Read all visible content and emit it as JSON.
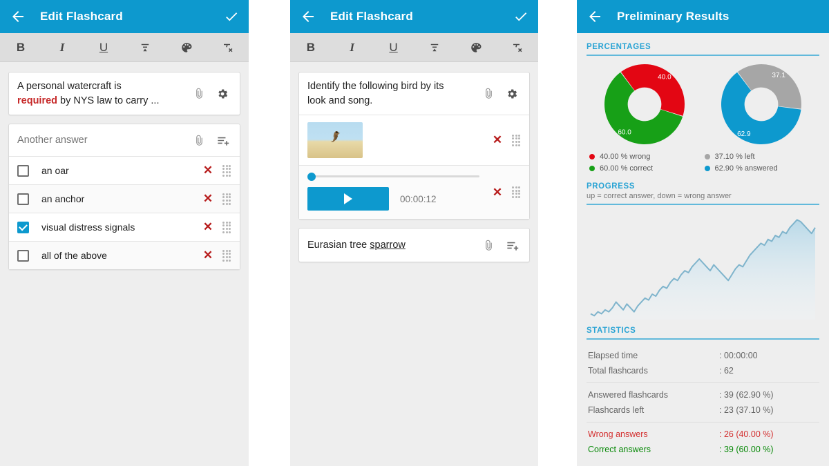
{
  "panel1": {
    "appbar": {
      "title": "Edit Flashcard",
      "back_icon": "back-arrow-icon",
      "confirm_icon": "check-icon"
    },
    "format_toolbar": [
      {
        "name": "bold",
        "glyph": "B"
      },
      {
        "name": "italic",
        "glyph": "I"
      },
      {
        "name": "underline",
        "glyph": "U"
      },
      {
        "name": "text-size",
        "glyph": "≡"
      },
      {
        "name": "text-color-palette",
        "glyph": "◕"
      },
      {
        "name": "clear-formatting",
        "glyph": "✗"
      }
    ],
    "question": {
      "line1": "A personal watercraft is",
      "keyword": "required",
      "line2_rest": " by NYS law to carry ...",
      "attach_icon": "paperclip-icon",
      "settings_icon": "gear-icon"
    },
    "answer_input": {
      "placeholder": "Another answer",
      "attach_icon": "paperclip-icon",
      "add_icon": "add-list-item-icon"
    },
    "answers": [
      {
        "label": "an oar",
        "checked": false
      },
      {
        "label": "an anchor",
        "checked": false
      },
      {
        "label": "visual distress signals",
        "checked": true
      },
      {
        "label": "all of the above",
        "checked": false
      }
    ]
  },
  "panel2": {
    "appbar": {
      "title": "Edit Flashcard",
      "back_icon": "back-arrow-icon",
      "confirm_icon": "check-icon"
    },
    "format_toolbar": [
      {
        "name": "bold",
        "glyph": "B"
      },
      {
        "name": "italic",
        "glyph": "I"
      },
      {
        "name": "underline",
        "glyph": "U"
      },
      {
        "name": "text-size",
        "glyph": "≡"
      },
      {
        "name": "text-color-palette",
        "glyph": "◕"
      },
      {
        "name": "clear-formatting",
        "glyph": "✗"
      }
    ],
    "question": {
      "line1": "Identify the following bird by its",
      "line2": "look and song.",
      "attach_icon": "paperclip-icon",
      "settings_icon": "gear-icon"
    },
    "image_attachment": {
      "alt": "bird-photo-thumbnail",
      "remove_icon": "remove-x-icon",
      "drag_icon": "drag-handle-icon"
    },
    "audio_attachment": {
      "duration": "00:00:12",
      "play_icon": "play-icon",
      "remove_icon": "remove-x-icon",
      "drag_icon": "drag-handle-icon",
      "seek_position_percent": 0
    },
    "answer": {
      "text_plain": "Eurasian tree ",
      "text_underlined": "sparrow",
      "attach_icon": "paperclip-icon",
      "add_icon": "add-list-item-icon"
    }
  },
  "panel3": {
    "appbar": {
      "title": "Preliminary Results",
      "back_icon": "back-arrow-icon"
    },
    "sections": {
      "percentages_title": "PERCENTAGES",
      "progress_title": "PROGRESS",
      "progress_subtitle": "up = correct answer, down = wrong answer",
      "statistics_title": "STATISTICS"
    },
    "legend": [
      {
        "label": "40.00 % wrong",
        "color": "#e30613"
      },
      {
        "label": "37.10 % left",
        "color": "#a6a6a6"
      },
      {
        "label": "60.00 % correct",
        "color": "#17a017"
      },
      {
        "label": "62.90 % answered",
        "color": "#0d99ce"
      }
    ],
    "statistics": [
      [
        {
          "key": "Elapsed time",
          "value": ": 00:00:00",
          "tone": "normal"
        },
        {
          "key": "Total flashcards",
          "value": ": 62",
          "tone": "normal"
        }
      ],
      [
        {
          "key": "Answered flashcards",
          "value": ": 39 (62.90 %)",
          "tone": "normal"
        },
        {
          "key": "Flashcards left",
          "value": ": 23 (37.10 %)",
          "tone": "normal"
        }
      ],
      [
        {
          "key": "Wrong answers",
          "value": ": 26 (40.00 %)",
          "tone": "wrong"
        },
        {
          "key": "Correct answers",
          "value": ": 39 (60.00 %)",
          "tone": "correct"
        }
      ]
    ]
  },
  "chart_data": [
    {
      "type": "pie",
      "title": "PERCENTAGES",
      "subtype": "donut",
      "name": "correctness-donut",
      "labels": [
        "wrong",
        "correct"
      ],
      "values": [
        40.0,
        60.0
      ],
      "data_labels": [
        "40.0",
        "60.0"
      ],
      "colors": [
        "#e30613",
        "#17a017"
      ],
      "legend": [
        "40.00 % wrong",
        "60.00 % correct"
      ],
      "legend_position": "bottom",
      "start_angle_deg": -36,
      "inner_radius_ratio": 0.42
    },
    {
      "type": "pie",
      "title": "PERCENTAGES",
      "subtype": "donut",
      "name": "completion-donut",
      "labels": [
        "left",
        "answered"
      ],
      "values": [
        37.1,
        62.9
      ],
      "data_labels": [
        "37.1",
        "62.9"
      ],
      "colors": [
        "#a6a6a6",
        "#0d99ce"
      ],
      "legend": [
        "37.10 % left",
        "62.90 % answered"
      ],
      "legend_position": "bottom",
      "start_angle_deg": -36,
      "inner_radius_ratio": 0.42
    },
    {
      "type": "area",
      "name": "progress-chart",
      "title": "PROGRESS",
      "subtitle": "up = correct answer, down = wrong answer",
      "xlabel": "",
      "ylabel": "",
      "grid": false,
      "legend_position": "none",
      "line_color": "#7fb4cc",
      "fill_top_color": "#b9d9e8",
      "fill_bottom_color": "#eef5f9",
      "x": [
        0,
        1,
        2,
        3,
        4,
        5,
        6,
        7,
        8,
        9,
        10,
        11,
        12,
        13,
        14,
        15,
        16,
        17,
        18,
        19,
        20,
        21,
        22,
        23,
        24,
        25,
        26,
        27,
        28,
        29,
        30,
        31,
        32,
        33,
        34,
        35,
        36,
        37,
        38,
        39,
        40,
        41,
        42,
        43,
        44,
        45,
        46,
        47,
        48,
        49,
        50,
        51,
        52,
        53,
        54,
        55,
        56,
        57,
        58,
        59,
        60,
        61,
        62
      ],
      "y": [
        3,
        2,
        4,
        3,
        5,
        4,
        6,
        9,
        7,
        5,
        8,
        6,
        4,
        7,
        9,
        11,
        10,
        13,
        12,
        15,
        17,
        16,
        19,
        21,
        20,
        23,
        25,
        24,
        27,
        29,
        31,
        29,
        27,
        25,
        28,
        26,
        24,
        22,
        20,
        23,
        26,
        28,
        27,
        30,
        33,
        35,
        37,
        39,
        38,
        41,
        40,
        43,
        42,
        45,
        44,
        47,
        49,
        51,
        50,
        48,
        46,
        44,
        47
      ],
      "ylim": [
        0,
        55
      ],
      "xlim": [
        0,
        62
      ]
    }
  ]
}
